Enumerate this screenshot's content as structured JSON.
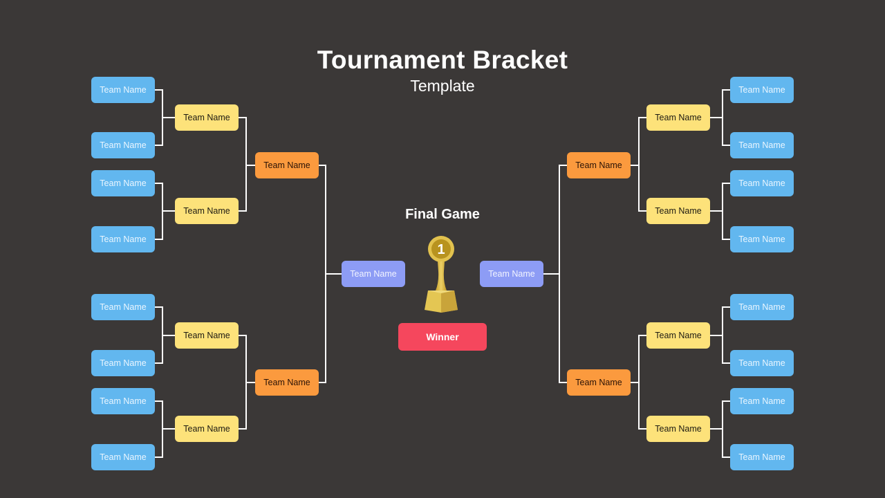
{
  "header": {
    "title": "Tournament Bracket",
    "subtitle": "Template"
  },
  "final": {
    "title": "Final Game",
    "trophy_icon": "trophy-icon",
    "trophy_number": "1",
    "winner_label": "Winner"
  },
  "colors": {
    "background": "#3b3837",
    "round1": "#62b7ef",
    "round2": "#fde27a",
    "round3": "#fb9a3e",
    "semifinal": "#8d9cf5",
    "winner": "#f5475d",
    "trophy": "#d9b53c",
    "connector": "#ffffff"
  },
  "left": {
    "round1": [
      "Team Name",
      "Team Name",
      "Team Name",
      "Team Name",
      "Team Name",
      "Team Name",
      "Team Name",
      "Team Name"
    ],
    "round2": [
      "Team Name",
      "Team Name",
      "Team Name",
      "Team Name"
    ],
    "round3": [
      "Team Name",
      "Team Name"
    ],
    "semifinal": "Team Name"
  },
  "right": {
    "round1": [
      "Team Name",
      "Team Name",
      "Team Name",
      "Team Name",
      "Team Name",
      "Team Name",
      "Team Name",
      "Team Name"
    ],
    "round2": [
      "Team Name",
      "Team Name",
      "Team Name",
      "Team Name"
    ],
    "round3": [
      "Team Name",
      "Team Name"
    ],
    "semifinal": "Team Name"
  }
}
